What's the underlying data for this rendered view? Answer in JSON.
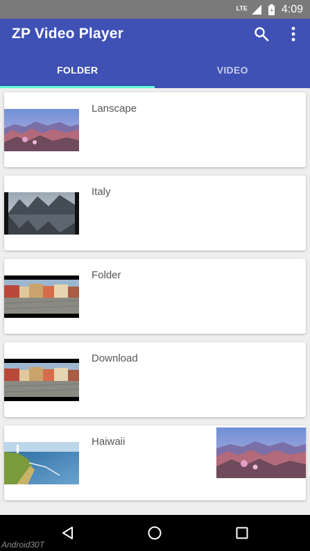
{
  "status_bar": {
    "network": "LTE",
    "time": "4:09"
  },
  "app_bar": {
    "title": "ZP Video Player",
    "search_icon": "search-icon",
    "more_icon": "more-vert-icon"
  },
  "tabs": [
    {
      "label": "FOLDER",
      "active": true
    },
    {
      "label": "VIDEO",
      "active": false
    }
  ],
  "folders": [
    {
      "name": "Lanscape",
      "thumbnail": "canyon-landscape"
    },
    {
      "name": "Italy",
      "thumbnail": "mountain-lake"
    },
    {
      "name": "Folder",
      "thumbnail": "town-square"
    },
    {
      "name": "Download",
      "thumbnail": "town-square"
    },
    {
      "name": "Haiwaii",
      "thumbnail": "coastal-cliffs",
      "extra_thumbnail": "canyon-landscape"
    }
  ],
  "nav_bar": {
    "back_icon": "back-icon",
    "home_icon": "home-icon",
    "recents_icon": "recents-icon"
  },
  "watermark": "Android30T",
  "colors": {
    "primary": "#3f51b5",
    "accent": "#64ffda",
    "status_bar": "#7a7a7a"
  }
}
